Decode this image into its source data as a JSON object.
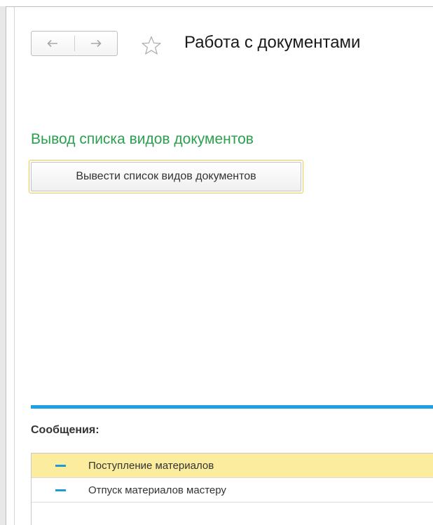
{
  "header": {
    "title": "Работа с документами",
    "back_icon": "arrow-left-icon",
    "forward_icon": "arrow-right-icon",
    "favorite_icon": "star-outline-icon"
  },
  "group": {
    "title": "Вывод списка видов документов",
    "title_color": "#2aa04e",
    "button_label": "Вывести список видов документов"
  },
  "messages": {
    "title": "Сообщения:",
    "accent_color": "#1da1e0",
    "selected_color": "#fbec9e",
    "items": [
      {
        "text": "Поступление материалов",
        "selected": true
      },
      {
        "text": "Отпуск материалов мастеру",
        "selected": false
      }
    ]
  }
}
